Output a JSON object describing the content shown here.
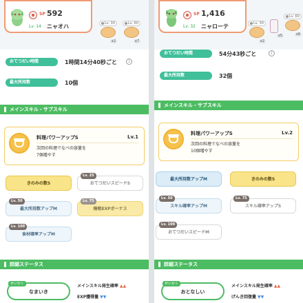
{
  "left": {
    "pokemon": {
      "sp_label": "SP",
      "sp": "592",
      "level": "Lv. 14",
      "name": "ニャオハ"
    },
    "foods": [
      {
        "level": "Lv. 30",
        "qty": "x2"
      },
      {
        "level": "Lv. 60",
        "qty": "x7"
      }
    ],
    "stats": [
      {
        "label": "おてつだい時間",
        "value": "1時間14分40秒ごと",
        "info": "i"
      },
      {
        "label": "最大所持数",
        "value": "10個"
      }
    ],
    "section_skills": "メインスキル・サブスキル",
    "main_skill": {
      "name": "料理パワーアップS",
      "level": "Lv.1",
      "desc_line1": "次回の料理でなべの容量を",
      "desc_line2": "7個増やす"
    },
    "sub_skills": [
      {
        "label": "きのみの数S",
        "lv": ""
      },
      {
        "label": "おてつだいスピードS",
        "lv": "Lv. 25"
      },
      {
        "label": "最大所持数アップM",
        "lv": "Lv. 50"
      },
      {
        "label": "睡眠EXPボーナス",
        "lv": "Lv. 75"
      },
      {
        "label": "食材確率アップM",
        "lv": "Lv. 100"
      }
    ],
    "section_detail": "詳細ステータス",
    "nature": {
      "tag": "せいかく",
      "value": "なまいき"
    },
    "nature_effects": [
      {
        "label": "メインスキル発生確率",
        "arrows": "▲▲",
        "dir": "up"
      },
      {
        "label": "EXP獲得量",
        "arrows": "▼▼",
        "dir": "down"
      }
    ]
  },
  "right": {
    "pokemon": {
      "sp_label": "SP",
      "sp": "1,416",
      "level": "Lv. 32",
      "name": "ニャローテ"
    },
    "foods": [
      {
        "level": "Lv. 30",
        "qty": "x2"
      },
      {
        "level": "",
        "qty": "x5"
      },
      {
        "level": "Lv. 60",
        "qty": "x6"
      }
    ],
    "stats": [
      {
        "label": "おてつだい時間",
        "value": "54分43秒ごと",
        "info": "i"
      },
      {
        "label": "最大所持数",
        "value": "32個"
      }
    ],
    "section_skills": "メインスキル・サブスキル",
    "main_skill": {
      "name": "料理パワーアップS",
      "level": "Lv.2",
      "desc_line1": "次回の料理でなべの容量を",
      "desc_line2": "10個増やす"
    },
    "sub_skills": [
      {
        "label": "最大所持数アップM",
        "lv": ""
      },
      {
        "label": "きのみの数S",
        "lv": ""
      },
      {
        "label": "スキル確率アップM",
        "lv": "Lv. 50"
      },
      {
        "label": "スキル確率アップS",
        "lv": "Lv. 75"
      },
      {
        "label": "おてつだいスピードM",
        "lv": "Lv. 100"
      }
    ],
    "section_detail": "詳細ステータス",
    "nature": {
      "tag": "せいかく",
      "value": "おとなしい"
    },
    "nature_effects": [
      {
        "label": "メインスキル発生確率",
        "arrows": "▲▲",
        "dir": "up"
      },
      {
        "label": "げんき回復量",
        "arrows": "▼▼",
        "dir": "down"
      }
    ]
  },
  "colors": {
    "accent_green": "#4cbc62",
    "stat_teal": "#3fbf9a",
    "skill_gold": "#f6c24c",
    "card_border": "#f09a74"
  }
}
